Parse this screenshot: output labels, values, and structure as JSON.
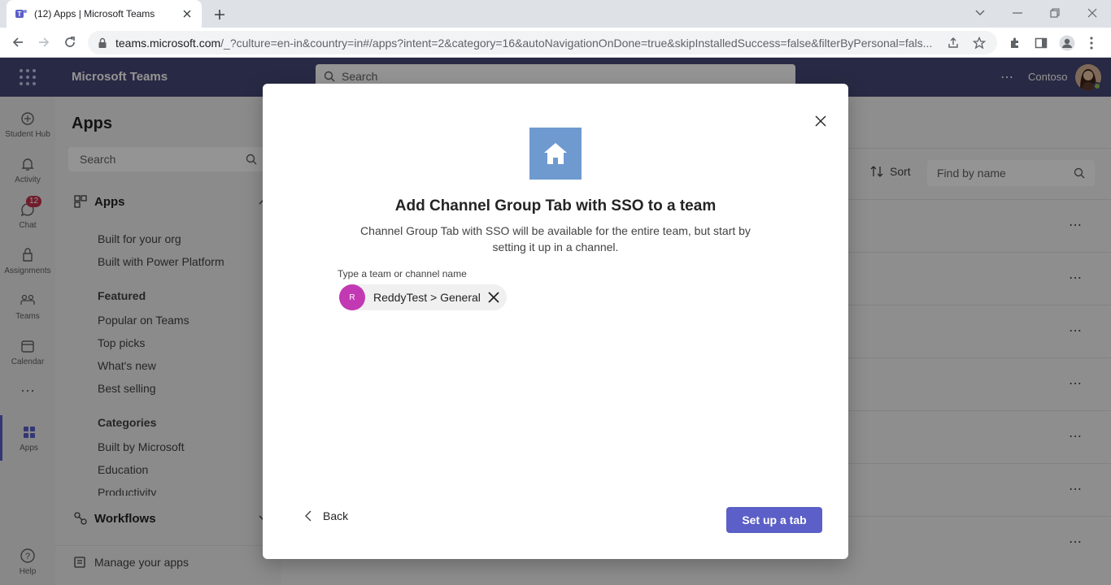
{
  "browser": {
    "tab_title": "(12) Apps | Microsoft Teams",
    "url_domain": "teams.microsoft.com",
    "url_path": "/_?culture=en-in&country=in#/apps?intent=2&category=16&autoNavigationOnDone=true&skipInstalledSuccess=false&filterByPersonal=fals..."
  },
  "teams": {
    "app_name": "Microsoft Teams",
    "search_placeholder": "Search",
    "org_name": "Contoso",
    "rail": [
      {
        "label": "Student Hub"
      },
      {
        "label": "Activity"
      },
      {
        "label": "Chat",
        "badge": "12"
      },
      {
        "label": "Assignments"
      },
      {
        "label": "Teams"
      },
      {
        "label": "Calendar"
      },
      {
        "label": "Apps"
      },
      {
        "label": "Help"
      }
    ],
    "left_pane": {
      "title": "Apps",
      "search_placeholder": "Search",
      "apps_section": "Apps",
      "org_items": [
        "Built for your org",
        "Built with Power Platform"
      ],
      "featured_heading": "Featured",
      "featured_items": [
        "Popular on Teams",
        "Top picks",
        "What's new",
        "Best selling"
      ],
      "categories_heading": "Categories",
      "category_items": [
        "Built by Microsoft",
        "Education",
        "Productivity"
      ],
      "workflows_section": "Workflows",
      "manage_apps": "Manage your apps"
    },
    "main": {
      "sort_label": "Sort",
      "find_placeholder": "Find by name"
    }
  },
  "dialog": {
    "title": "Add Channel Group Tab with SSO to a team",
    "description": "Channel Group Tab with SSO will be available for the entire team, but start by setting it up in a channel.",
    "field_label": "Type a team or channel name",
    "selected_chip": {
      "initial": "R",
      "text": "ReddyTest > General"
    },
    "back_label": "Back",
    "primary_label": "Set up a tab"
  },
  "colors": {
    "teams_header": "#464775",
    "primary": "#5b5fc7",
    "app_tile": "#6f9ad0",
    "chip_avatar": "#c239b3",
    "badge": "#c4314b"
  }
}
